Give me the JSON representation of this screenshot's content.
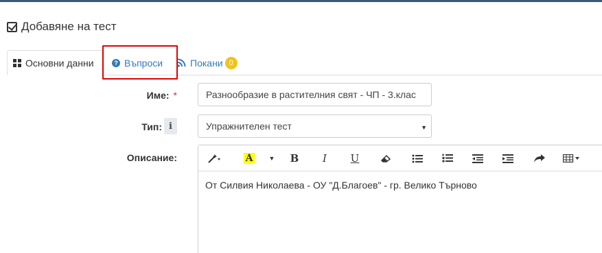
{
  "header": {
    "title": "Добавяне на тест",
    "icon": "check-square-icon"
  },
  "tabs": [
    {
      "label": "Основни данни",
      "icon": "th-large-icon",
      "active": true
    },
    {
      "label": "Въпроси",
      "icon": "question-circle-icon",
      "active": false
    },
    {
      "label": "Покани",
      "icon": "rss-icon",
      "badge": "0",
      "active": false
    }
  ],
  "form": {
    "name": {
      "label": "Име:",
      "required_mark": "*",
      "value": "Разнообразие в растителния свят - ЧП - 3.клас"
    },
    "type": {
      "label": "Тип:",
      "info_glyph": "i",
      "value": "Упражнителен тест"
    },
    "description": {
      "label": "Описание:",
      "content": "От Силвия Николаева - ОУ \"Д.Благоев\" - гр. Велико Търново"
    }
  },
  "toolbar": {
    "bold": "B",
    "italic": "I",
    "underline": "U",
    "color_letter": "A"
  },
  "colors": {
    "accent": "#337ab7",
    "highlight_box": "#e00000",
    "badge": "#f0c419",
    "top_bar": "#3c5877"
  }
}
